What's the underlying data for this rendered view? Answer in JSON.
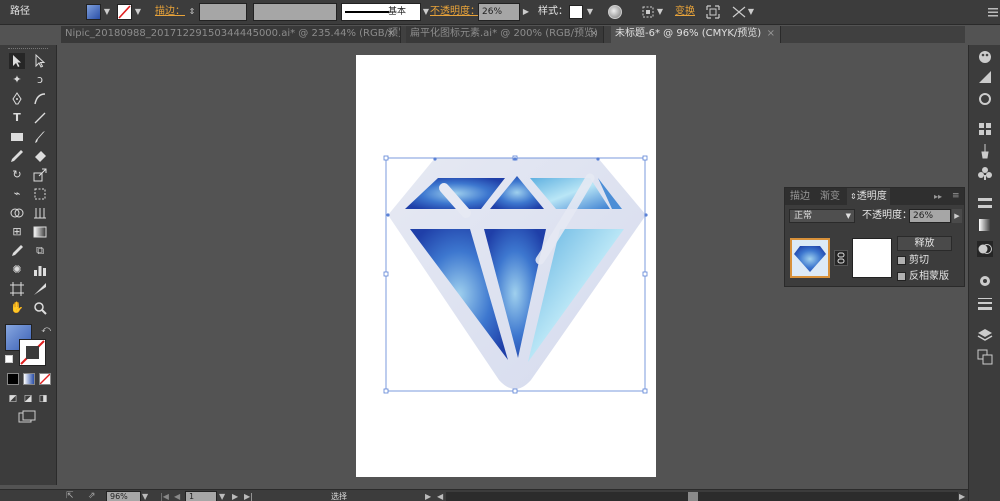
{
  "control_bar": {
    "selection_label": "路径",
    "stroke_label": "描边：",
    "stroke_profile": "基本",
    "opacity_label": "不透明度：",
    "opacity_value": "26%",
    "style_label": "样式：",
    "transform_label": "变换"
  },
  "tabs": [
    {
      "label": "Nipic_20180988_20171229150344445000.ai* @ 235.44% (RGB/预览)",
      "active": false
    },
    {
      "label": "扁平化图标元素.ai* @ 200% (RGB/预览)",
      "active": false
    },
    {
      "label": "未标题-6* @ 96% (CMYK/预览)",
      "active": true
    }
  ],
  "tab_close": "×",
  "transparency_panel": {
    "tabs": [
      "描边",
      "渐变",
      "透明度"
    ],
    "blend_mode": "正常",
    "opacity_label": "不透明度：",
    "opacity_value": "26%",
    "release_button": "释放",
    "clip_label": "剪切",
    "invert_mask_label": "反相蒙版"
  },
  "status_bar": {
    "zoom": "96%",
    "page": "1",
    "tool_name": "选择"
  },
  "colors": {
    "diamond_dark": "#1f4fb4",
    "diamond_light": "#8fc8ea",
    "diamond_outline": "#dde2f0",
    "selection": "#5b82d6"
  }
}
